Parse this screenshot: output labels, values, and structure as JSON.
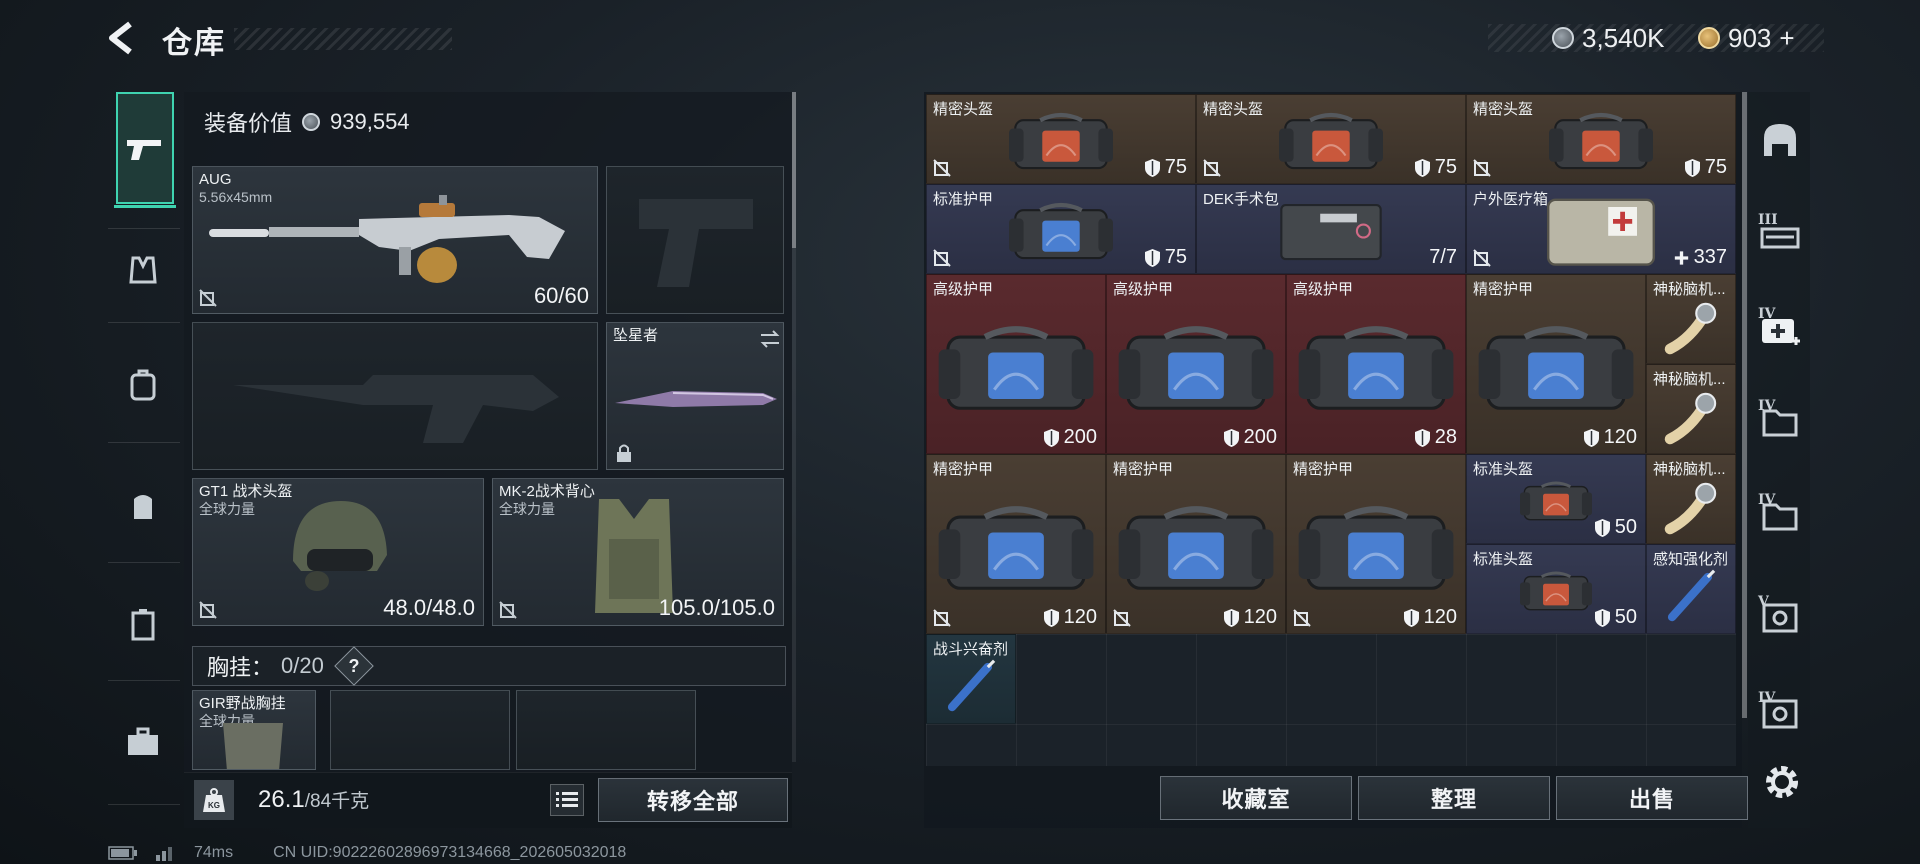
{
  "header": {
    "title": "仓库",
    "currency_silver": "3,540K",
    "currency_gold": "903",
    "currency_gold_suffix": "+"
  },
  "left_tabs": [
    "pistol-icon",
    "vest-icon",
    "armor-icon",
    "backpack-icon",
    "rig-icon",
    "case-icon"
  ],
  "equipment": {
    "value_label": "装备价值",
    "value": "939,554",
    "primary_weapon": {
      "name": "AUG",
      "caliber": "5.56x45mm",
      "ammo": "60/60"
    },
    "melee": {
      "name": "坠星者"
    },
    "helmet": {
      "name": "GT1 战术头盔",
      "tag": "全球力量",
      "durability": "48.0/48.0"
    },
    "vest": {
      "name": "MK-2战术背心",
      "tag": "全球力量",
      "durability": "105.0/105.0"
    },
    "chest_rig": {
      "label": "胸挂：",
      "count": "0/20",
      "help": "?"
    },
    "rig_item": {
      "name": "GIR野战胸挂",
      "tag": "全球力量"
    }
  },
  "weight": {
    "current": "26.1",
    "max": "/84千克",
    "kg_label": "KG"
  },
  "buttons": {
    "transfer_all": "转移全部",
    "collection": "收藏室",
    "sort": "整理",
    "sell": "出售"
  },
  "status": {
    "ping": "74ms",
    "uid": "CN UID:90222602896973134668_202605032018"
  },
  "stash_items": [
    {
      "name": "精密头盔",
      "value": "75",
      "icon": "shield",
      "color": "brown"
    },
    {
      "name": "精密头盔",
      "value": "75",
      "icon": "shield",
      "color": "brown"
    },
    {
      "name": "精密头盔",
      "value": "75",
      "icon": "shield",
      "color": "brown"
    },
    {
      "name": "标准护甲",
      "value": "75",
      "icon": "shield",
      "color": "blue"
    },
    {
      "name": "DEK手术包",
      "value": "7/7",
      "icon": "none",
      "color": "blue"
    },
    {
      "name": "户外医疗箱",
      "value": "337",
      "icon": "plus",
      "color": "blue"
    },
    {
      "name": "高级护甲",
      "value": "200",
      "icon": "shield",
      "color": "red"
    },
    {
      "name": "高级护甲",
      "value": "200",
      "icon": "shield",
      "color": "red"
    },
    {
      "name": "高级护甲",
      "value": "28",
      "icon": "shield",
      "color": "red"
    },
    {
      "name": "精密护甲",
      "value": "120",
      "icon": "shield",
      "color": "brown"
    },
    {
      "name": "神秘脑机...",
      "value": "",
      "icon": "none",
      "color": "brown"
    },
    {
      "name": "神秘脑机...",
      "value": "",
      "icon": "none",
      "color": "brown"
    },
    {
      "name": "精密护甲",
      "value": "120",
      "icon": "shield",
      "color": "brown"
    },
    {
      "name": "精密护甲",
      "value": "120",
      "icon": "shield",
      "color": "brown"
    },
    {
      "name": "精密护甲",
      "value": "120",
      "icon": "shield",
      "color": "brown"
    },
    {
      "name": "标准头盔",
      "value": "50",
      "icon": "shield",
      "color": "blue"
    },
    {
      "name": "神秘脑机...",
      "value": "",
      "icon": "none",
      "color": "brown"
    },
    {
      "name": "标准头盔",
      "value": "50",
      "icon": "shield",
      "color": "blue"
    },
    {
      "name": "感知强化剂",
      "value": "",
      "icon": "none",
      "color": "blue"
    },
    {
      "name": "战斗兴奋剂",
      "value": "",
      "icon": "none",
      "color": "teal"
    }
  ],
  "right_tabs": [
    {
      "roman": "",
      "icon": "helmet-icon"
    },
    {
      "roman": "III",
      "icon": "rifle-box-icon"
    },
    {
      "roman": "IV",
      "icon": "medkit-icon"
    },
    {
      "roman": "IV",
      "icon": "folder-icon"
    },
    {
      "roman": "IV",
      "icon": "folder-icon"
    },
    {
      "roman": "V",
      "icon": "safe-icon"
    },
    {
      "roman": "IV",
      "icon": "safe-icon"
    }
  ],
  "colors": {
    "accent": "#3fd3b0",
    "brown_tile": "#4a3e33",
    "blue_tile": "#353a52",
    "red_tile": "#5a2a2e"
  }
}
